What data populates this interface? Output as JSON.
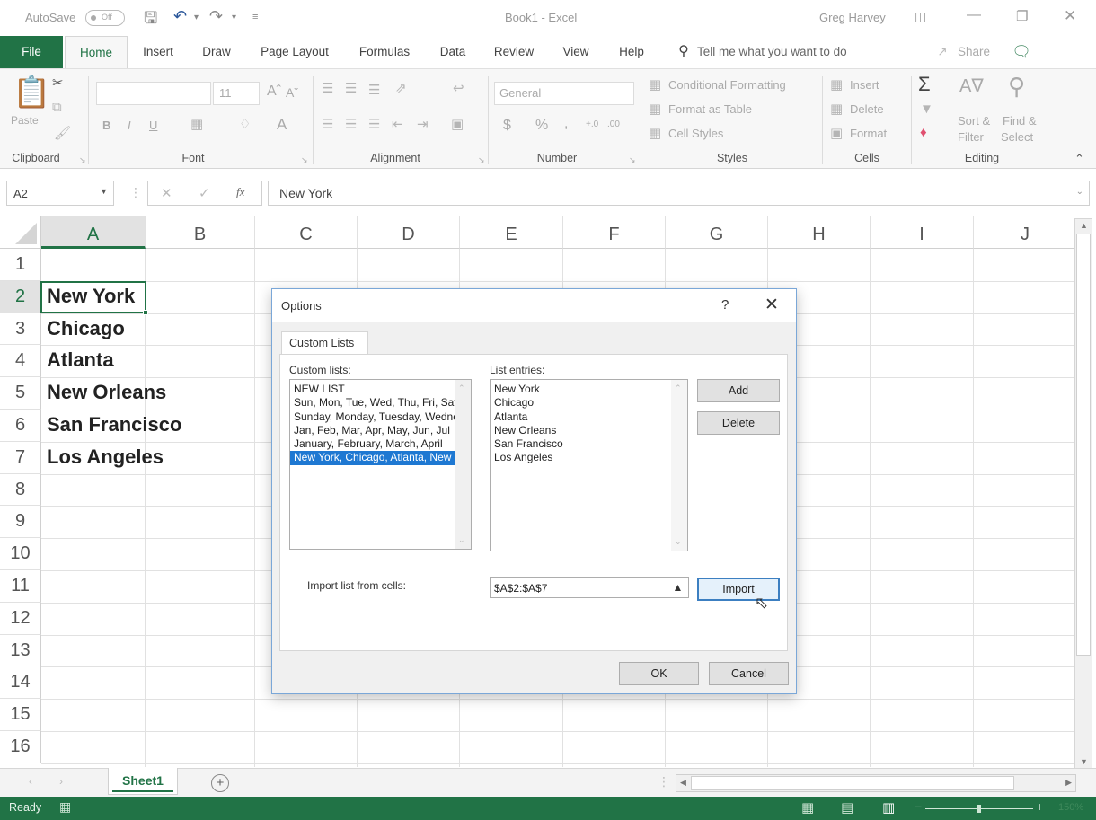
{
  "titlebar": {
    "autosave_label": "AutoSave",
    "autosave_state": "Off",
    "doc_title": "Book1  -  Excel",
    "user": "Greg Harvey",
    "icons": [
      "save-icon",
      "undo-icon",
      "redo-icon",
      "customize-qat-icon",
      "ribbon-display-icon",
      "minimize-icon",
      "restore-icon",
      "close-icon"
    ]
  },
  "tabs": [
    {
      "label": "File"
    },
    {
      "label": "Home"
    },
    {
      "label": "Insert"
    },
    {
      "label": "Draw"
    },
    {
      "label": "Page Layout"
    },
    {
      "label": "Formulas"
    },
    {
      "label": "Data"
    },
    {
      "label": "Review"
    },
    {
      "label": "View"
    },
    {
      "label": "Help"
    }
  ],
  "tell_me": "Tell me what you want to do",
  "share": "Share",
  "ribbon": {
    "clipboard": {
      "label": "Clipboard",
      "paste": "Paste"
    },
    "font": {
      "label": "Font",
      "size": "11",
      "bold": "B",
      "italic": "I",
      "underline": "U"
    },
    "alignment": {
      "label": "Alignment"
    },
    "number": {
      "label": "Number",
      "format": "General",
      "currency": "$",
      "percent": "%",
      "comma": ","
    },
    "styles": {
      "label": "Styles",
      "conditional": "Conditional Formatting",
      "format_table": "Format as Table",
      "cell_styles": "Cell Styles"
    },
    "cells": {
      "label": "Cells",
      "insert": "Insert",
      "delete": "Delete",
      "format": "Format"
    },
    "editing": {
      "label": "Editing",
      "sort_filter_1": "Sort &",
      "sort_filter_2": "Filter",
      "find_select_1": "Find &",
      "find_select_2": "Select"
    }
  },
  "formula_bar": {
    "name_box": "A2",
    "cancel": "✕",
    "enter": "✓",
    "fx": "fx",
    "value": "New York"
  },
  "grid": {
    "columns": [
      "A",
      "B",
      "C",
      "D",
      "E",
      "F",
      "G",
      "H",
      "I",
      "J"
    ],
    "rows": [
      "1",
      "2",
      "3",
      "4",
      "5",
      "6",
      "7",
      "8",
      "9",
      "10",
      "11",
      "12",
      "13",
      "14",
      "15",
      "16"
    ],
    "selected_cell": "A2",
    "cells": [
      {
        "ref": "A2",
        "value": "New York"
      },
      {
        "ref": "A3",
        "value": "Chicago"
      },
      {
        "ref": "A4",
        "value": "Atlanta"
      },
      {
        "ref": "A5",
        "value": "New Orleans"
      },
      {
        "ref": "A6",
        "value": "San Francisco"
      },
      {
        "ref": "A7",
        "value": "Los Angeles"
      }
    ]
  },
  "sheets": {
    "tabs": [
      "Sheet1"
    ],
    "active": "Sheet1",
    "add_label": "+"
  },
  "status": {
    "ready": "Ready",
    "zoom": "150%"
  },
  "dialog": {
    "title": "Options",
    "help": "?",
    "close": "✕",
    "tab": "Custom Lists",
    "custom_lists_label": "Custom lists:",
    "custom_lists": [
      {
        "text": "NEW LIST",
        "selected": false
      },
      {
        "text": "Sun, Mon, Tue, Wed, Thu, Fri, Sat",
        "selected": false
      },
      {
        "text": "Sunday, Monday, Tuesday, Wednesday",
        "selected": false
      },
      {
        "text": "Jan, Feb, Mar, Apr, May, Jun, Jul",
        "selected": false
      },
      {
        "text": "January, February, March, April",
        "selected": false
      },
      {
        "text": "New York, Chicago, Atlanta, New Orleans",
        "selected": true
      }
    ],
    "entries_label": "List entries:",
    "entries": [
      "New York",
      "Chicago",
      "Atlanta",
      "New Orleans",
      "San Francisco",
      "Los Angeles"
    ],
    "add": "Add",
    "delete": "Delete",
    "import_label": "Import list from cells:",
    "import_ref": "$A$2:$A$7",
    "import": "Import",
    "ok": "OK",
    "cancel": "Cancel"
  }
}
